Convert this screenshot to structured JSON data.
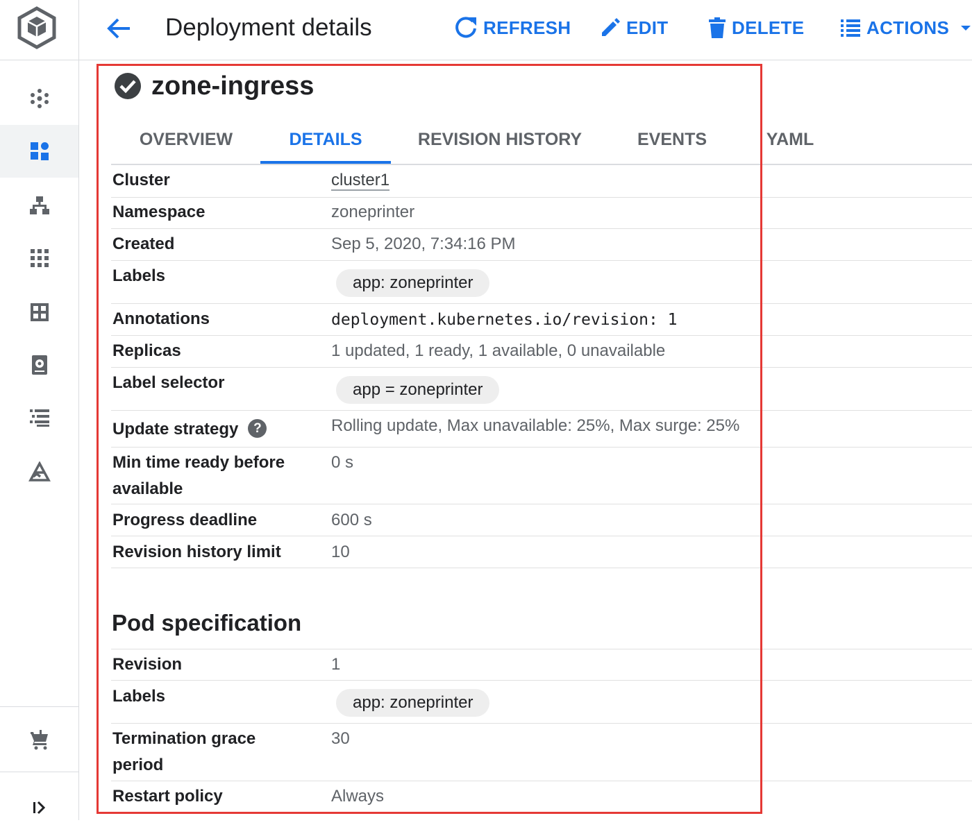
{
  "header": {
    "title": "Deployment details",
    "refresh_label": "REFRESH",
    "edit_label": "EDIT",
    "delete_label": "DELETE",
    "actions_label": "ACTIONS"
  },
  "resource": {
    "name": "zone-ingress",
    "status": "check-circle-icon"
  },
  "tabs": [
    {
      "label": "OVERVIEW",
      "active": false
    },
    {
      "label": "DETAILS",
      "active": true
    },
    {
      "label": "REVISION HISTORY",
      "active": false
    },
    {
      "label": "EVENTS",
      "active": false
    },
    {
      "label": "YAML",
      "active": false
    }
  ],
  "details": {
    "cluster": {
      "label": "Cluster",
      "value": "cluster1"
    },
    "namespace": {
      "label": "Namespace",
      "value": "zoneprinter"
    },
    "created": {
      "label": "Created",
      "value": "Sep 5, 2020, 7:34:16 PM"
    },
    "labels": {
      "label": "Labels",
      "chip": "app: zoneprinter"
    },
    "annotations": {
      "label": "Annotations",
      "value": "deployment.kubernetes.io/revision: 1"
    },
    "replicas": {
      "label": "Replicas",
      "value": "1 updated, 1 ready, 1 available, 0 unavailable"
    },
    "label_selector": {
      "label": "Label selector",
      "chip": "app = zoneprinter"
    },
    "update_strategy": {
      "label": "Update strategy",
      "help": "?",
      "value": "Rolling update, Max unavailable: 25%, Max surge: 25%"
    },
    "min_ready": {
      "label_line1": "Min time ready before",
      "label_line2": "available",
      "value": "0 s"
    },
    "progress_deadline": {
      "label": "Progress deadline",
      "value": "600 s"
    },
    "revision_history_limit": {
      "label": "Revision history limit",
      "value": "10"
    }
  },
  "pod_spec": {
    "title": "Pod specification",
    "revision": {
      "label": "Revision",
      "value": "1"
    },
    "labels": {
      "label": "Labels",
      "chip": "app: zoneprinter"
    },
    "termination_grace": {
      "label_line1": "Termination grace",
      "label_line2": "period",
      "value": "30"
    },
    "restart_policy": {
      "label": "Restart policy",
      "value": "Always"
    }
  },
  "sidebar": {
    "icons": [
      "kubernetes-engine-logo",
      "clusters-icon",
      "workloads-icon",
      "services-icon",
      "applications-icon",
      "configuration-icon",
      "storage-icon",
      "object-browser-icon",
      "migrate-icon",
      "marketplace-icon",
      "expand-rail-icon"
    ]
  },
  "colors": {
    "accent": "#1a73e8",
    "highlight_frame": "#e53935",
    "label_text": "#202124",
    "value_text": "#5f6368"
  }
}
